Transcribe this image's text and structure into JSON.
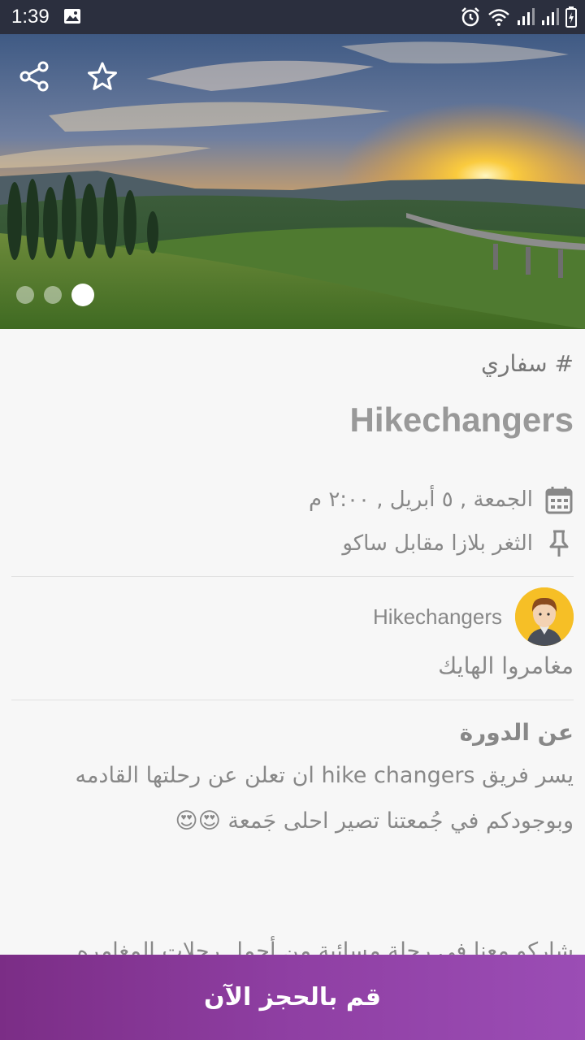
{
  "status_bar": {
    "time": "1:39"
  },
  "hero": {
    "slide_count": 3,
    "active_slide": 3
  },
  "event": {
    "category": "# سفاري",
    "title": "Hikechangers",
    "date": "الجمعة , ٥ أبريل , ٢:٠٠ م",
    "location": "الثغر بلازا مقابل ساكو"
  },
  "organizer": {
    "name": "Hikechangers",
    "description": "مغامروا الهايك"
  },
  "about": {
    "title": "عن الدورة",
    "line1": "يسر فريق hike changers ان تعلن عن رحلتها القادمه",
    "line2": "وبوجودكم في جُمعتنا تصير احلى جَمعة 😍😍",
    "line3": "شاركو معنا في رحلة مسائية من أجمل رحلات المغامره"
  },
  "booking": {
    "label": "قم بالحجز الآن"
  },
  "colors": {
    "accent": "#8f3fa3",
    "status_bar": "#2b2f3e"
  }
}
